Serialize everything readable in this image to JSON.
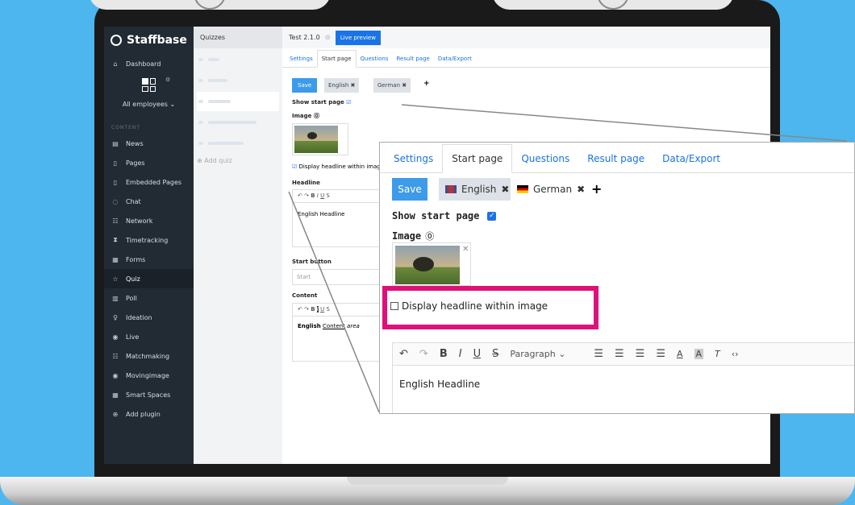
{
  "app": {
    "name": "Staffbase"
  },
  "sidebar": {
    "dashboard": "Dashboard",
    "employees": "All employees",
    "section_label": "CONTENT",
    "items": [
      {
        "label": "News",
        "icon": "news-icon"
      },
      {
        "label": "Pages",
        "icon": "page-icon"
      },
      {
        "label": "Embedded Pages",
        "icon": "embed-icon"
      },
      {
        "label": "Chat",
        "icon": "chat-icon"
      },
      {
        "label": "Network",
        "icon": "network-icon"
      },
      {
        "label": "Timetracking",
        "icon": "hourglass-icon"
      },
      {
        "label": "Forms",
        "icon": "forms-icon"
      },
      {
        "label": "Quiz",
        "icon": "star-icon"
      },
      {
        "label": "Poll",
        "icon": "bar-chart-icon"
      },
      {
        "label": "Ideation",
        "icon": "bulb-icon"
      },
      {
        "label": "Live",
        "icon": "live-icon"
      },
      {
        "label": "Matchmaking",
        "icon": "match-icon"
      },
      {
        "label": "Movingimage",
        "icon": "video-icon"
      },
      {
        "label": "Smart Spaces",
        "icon": "spaces-icon"
      },
      {
        "label": "Add plugin",
        "icon": "plus-circle-icon"
      }
    ]
  },
  "quizzes": {
    "header": "Quizzes",
    "add": "Add quiz"
  },
  "editor": {
    "title": "Test 2.1.0",
    "live_preview": "Live preview",
    "tabs": [
      "Settings",
      "Start page",
      "Questions",
      "Result page",
      "Data/Export"
    ],
    "save": "Save",
    "lang1": "English",
    "lang2": "German",
    "show_start_page": "Show start page",
    "image_label": "Image",
    "display_headline": "Display headline within image",
    "headline_label": "Headline",
    "headline_text": "English Headline",
    "start_button_label": "Start button",
    "start_button_value": "Start",
    "content_label": "Content",
    "content_text_bold": "English",
    "content_text_u": "Content",
    "content_text_i": "area"
  },
  "zoom": {
    "tabs": [
      "Settings",
      "Start page",
      "Questions",
      "Result page",
      "Data/Export"
    ],
    "save": "Save",
    "lang1": "English",
    "lang2": "German",
    "show_start_page": "Show start page",
    "image_label": "Image",
    "display_headline": "Display headline within image",
    "paragraph": "Paragraph",
    "headline_text": "English Headline"
  },
  "colors": {
    "background": "#4db6ee",
    "highlight": "#e0107a",
    "accent": "#1a73e8"
  }
}
